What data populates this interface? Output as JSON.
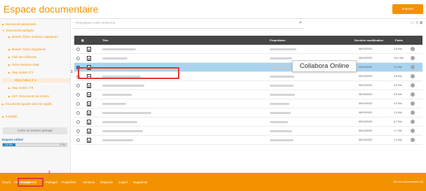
{
  "app": {
    "title": "Espace documentaire",
    "import_label": "Importer"
  },
  "search": {
    "placeholder": "Renseignez votre recherche"
  },
  "sidebar": {
    "items": [
      "Documents personnels",
      "Documents partagés",
      "6eme6- fiches animaux migrateurs",
      "6eme6- fiches migrateurs",
      "Club des référents",
      "Fiche révisions DNB",
      "Stop motion 4°2",
      "Stop motion 4°4",
      "Stop motion 4°8",
      "SVT- Documents de rentrée",
      "Documents ajoutés dans les applis",
      "Corbeille"
    ],
    "create_label": "Créer un dossier partagé",
    "space_label": "Espace utilisé",
    "space_used": "3.6 Mo",
    "space_total": "3 Go",
    "space_fraction": 0.2
  },
  "table": {
    "headers": {
      "title": "Titre",
      "owner": "Propriétaire",
      "modified": "Dernière modification",
      "weight": "Poids"
    },
    "rows": [
      {
        "date": "06/10/2023",
        "weight": "2.8 Mo",
        "selected": false
      },
      {
        "date": "06/10/2023",
        "weight": "14.2 Mo",
        "selected": false
      },
      {
        "date": "06/10/2023",
        "weight": "2.4 Mo",
        "selected": true
      },
      {
        "date": "06/10/2023",
        "weight": "3.8 Mo",
        "selected": false
      },
      {
        "date": "06/10/2023",
        "weight": "9.9 Mo",
        "selected": false
      },
      {
        "date": "06/10/2023",
        "weight": "5.9 Mo",
        "selected": false
      },
      {
        "date": "06/10/2023",
        "weight": "4.3 Mo",
        "selected": false
      },
      {
        "date": "06/10/2023",
        "weight": "2.3 Mo",
        "selected": false
      },
      {
        "date": "06/10/2023",
        "weight": "5.7 Mo",
        "selected": false
      },
      {
        "date": "06/10/2023",
        "weight": "1.7 Mo",
        "selected": false
      },
      {
        "date": "06/10/2023",
        "weight": "1.1 Mo",
        "selected": false
      }
    ]
  },
  "tooltip": "Collabora Online",
  "markers": {
    "one": "1",
    "two": "2"
  },
  "footer": {
    "actions": [
      "Ouvrir",
      "Télécharger",
      "Commenter",
      "Partager",
      "Propriétés",
      "Versions",
      "Déplacer",
      "Copier",
      "Supprimer"
    ],
    "comments_link": "Voir les commentaires (0)"
  },
  "colors": {
    "accent": "#f39200",
    "selection": "#a9d3ee",
    "highlight": "#e53935",
    "header": "#464646"
  }
}
